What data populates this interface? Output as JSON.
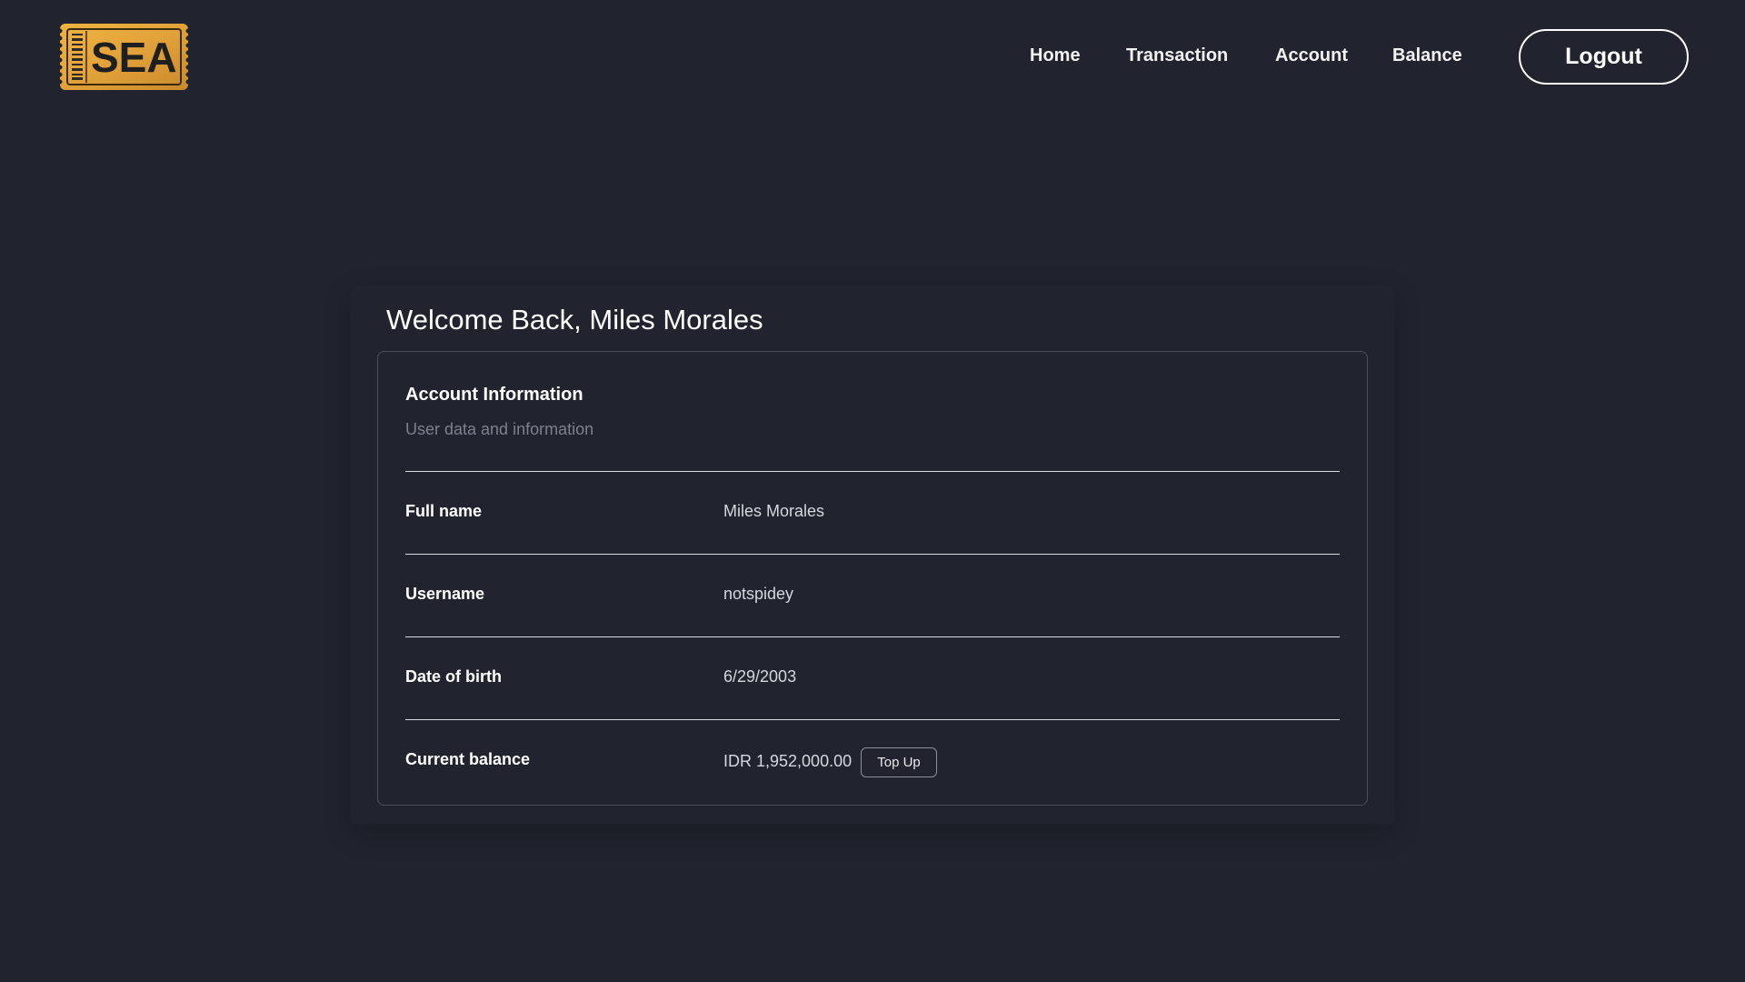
{
  "brand": {
    "logo_text": "SEA"
  },
  "nav": {
    "items": [
      {
        "label": "Home"
      },
      {
        "label": "Transaction"
      },
      {
        "label": "Account"
      },
      {
        "label": "Balance"
      }
    ],
    "logout_label": "Logout"
  },
  "main": {
    "welcome": "Welcome Back, Miles Morales",
    "card": {
      "title": "Account Information",
      "subtitle": "User data and information",
      "rows": [
        {
          "label": "Full name",
          "value": "Miles Morales"
        },
        {
          "label": "Username",
          "value": "notspidey"
        },
        {
          "label": "Date of birth",
          "value": "6/29/2003"
        },
        {
          "label": "Current balance",
          "value": "IDR 1,952,000.00"
        }
      ],
      "topup_label": "Top Up"
    }
  },
  "colors": {
    "background": "#21242f",
    "logo_gold": "#e6a532",
    "border": "#4a4f5c",
    "muted_text": "#7c818e"
  }
}
